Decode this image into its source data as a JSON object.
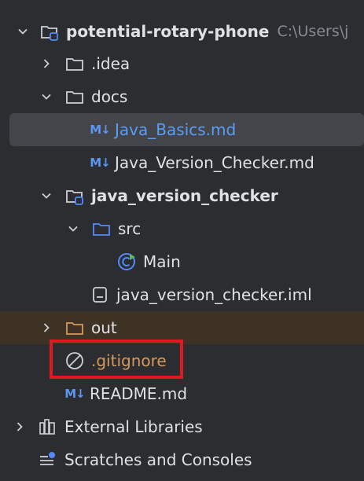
{
  "colors": {
    "background": "#2b2d30",
    "selected_row": "#43454a",
    "excluded_row": "#3d3223",
    "text": "#dfe1e5",
    "path_text": "#868a91",
    "markdown_blue": "#589df6",
    "ignored_orange": "#d49a5f",
    "highlight_red": "#e0181f"
  },
  "tree": {
    "project": {
      "name": "potential-rotary-phone",
      "path": "C:\\Users\\j",
      "icon": "module-folder-icon"
    },
    "idea": {
      "name": ".idea",
      "icon": "folder-icon"
    },
    "docs": {
      "name": "docs",
      "icon": "folder-icon"
    },
    "java_basics": {
      "name": "Java_Basics.md",
      "icon": "markdown-icon",
      "icon_text": "M↓"
    },
    "java_version_checker_md": {
      "name": "Java_Version_Checker.md",
      "icon": "markdown-icon",
      "icon_text": "M↓"
    },
    "module": {
      "name": "java_version_checker",
      "icon": "module-folder-icon"
    },
    "src": {
      "name": "src",
      "icon": "source-folder-icon"
    },
    "main": {
      "name": "Main",
      "icon": "java-class-icon"
    },
    "iml": {
      "name": "java_version_checker.iml",
      "icon": "iml-file-icon"
    },
    "out": {
      "name": "out",
      "icon": "excluded-folder-icon"
    },
    "gitignore": {
      "name": ".gitignore",
      "icon": "ignored-file-icon"
    },
    "readme": {
      "name": "README.md",
      "icon": "markdown-icon",
      "icon_text": "M↓"
    },
    "external_libraries": {
      "name": "External Libraries",
      "icon": "libraries-icon"
    },
    "scratches": {
      "name": "Scratches and Consoles",
      "icon": "scratches-icon"
    }
  }
}
